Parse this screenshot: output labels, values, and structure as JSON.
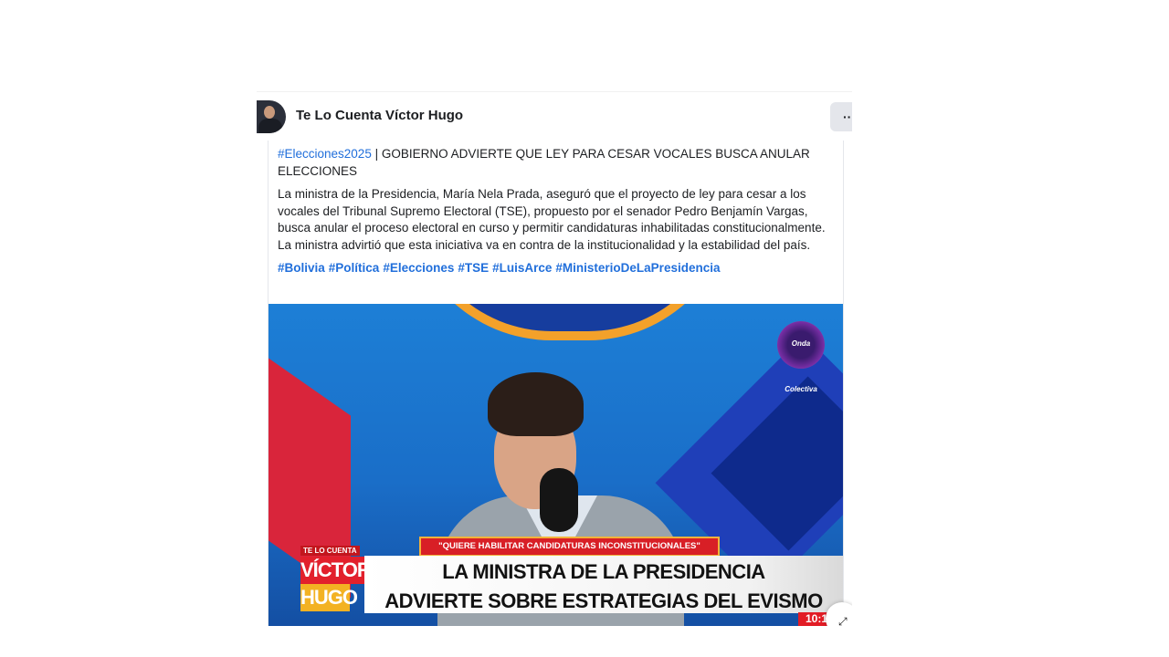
{
  "header": {
    "page_name": "Te Lo Cuenta Víctor Hugo",
    "more_label": "···"
  },
  "post": {
    "headline_hashtag": "#Elecciones2025",
    "headline_text": " | GOBIERNO ADVIERTE QUE LEY PARA CESAR VOCALES BUSCA ANULAR ELECCIONES",
    "body": "La ministra de la Presidencia, María Nela Prada, aseguró que el proyecto de ley para cesar a los vocales del Tribunal Supremo Electoral (TSE), propuesto por el senador Pedro Benjamín Vargas, busca anular el proceso electoral en curso y permitir candidaturas inhabilitadas constitucionalmente. La ministra advirtió que esta iniciativa va en contra de la institucionalidad y la estabilidad del país.",
    "tags": [
      "#Bolivia",
      "#Política",
      "#Elecciones",
      "#TSE",
      "#LuisArce",
      "#MinisterioDeLaPresidencia"
    ]
  },
  "video": {
    "channel_badge": "Onda Colectiva",
    "quote": "\"QUIERE HABILITAR CANDIDATURAS INCONSTITUCIONALES\"",
    "brand_top": "TE LO CUENTA",
    "brand_line1": "VÍCTOR",
    "brand_line2": "HUGO",
    "headline_line1": "LA MINISTRA DE LA PRESIDENCIA",
    "headline_line2": "ADVIERTE SOBRE ESTRATEGIAS DEL EVISMO",
    "time": "10:1"
  },
  "colors": {
    "link": "#216fdb",
    "accent_red": "#d81f26",
    "accent_yellow": "#f3b223"
  }
}
